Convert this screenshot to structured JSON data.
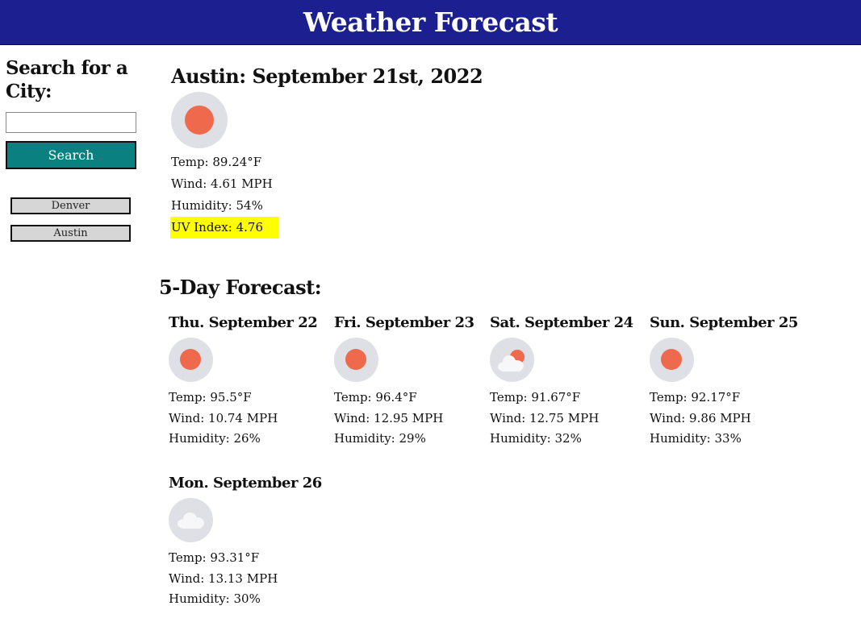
{
  "header": {
    "title": "Weather Forecast"
  },
  "sidebar": {
    "title": "Search for a City:",
    "search_placeholder": "",
    "search_value": "",
    "search_label": "Search",
    "history": [
      "Denver",
      "Austin"
    ]
  },
  "current": {
    "title": "Austin: September 21st, 2022",
    "icon": "sun-icon",
    "temp": "Temp: 89.24°F",
    "wind": "Wind: 4.61 MPH",
    "humidity": "Humidity: 54%",
    "uv": "UV Index: 4.76"
  },
  "forecast": {
    "title": "5-Day Forecast:",
    "days": [
      {
        "title": "Thu. September 22",
        "icon": "sun-icon",
        "temp": "Temp: 95.5°F",
        "wind": "Wind: 10.74 MPH",
        "humidity": "Humidity: 26%"
      },
      {
        "title": "Fri. September 23",
        "icon": "sun-icon",
        "temp": "Temp: 96.4°F",
        "wind": "Wind: 12.95 MPH",
        "humidity": "Humidity: 29%"
      },
      {
        "title": "Sat. September 24",
        "icon": "partly-cloudy-icon",
        "temp": "Temp: 91.67°F",
        "wind": "Wind: 12.75 MPH",
        "humidity": "Humidity: 32%"
      },
      {
        "title": "Sun. September 25",
        "icon": "sun-icon",
        "temp": "Temp: 92.17°F",
        "wind": "Wind: 9.86 MPH",
        "humidity": "Humidity: 33%"
      },
      {
        "title": "Mon. September 26",
        "icon": "cloud-icon",
        "temp": "Temp: 93.31°F",
        "wind": "Wind: 13.13 MPH",
        "humidity": "Humidity: 30%"
      }
    ]
  },
  "colors": {
    "header_bg": "#1b1f8f",
    "search_button_bg": "#0b8080",
    "sun": "#ef6a4c",
    "uv_highlight": "#ffff00"
  }
}
